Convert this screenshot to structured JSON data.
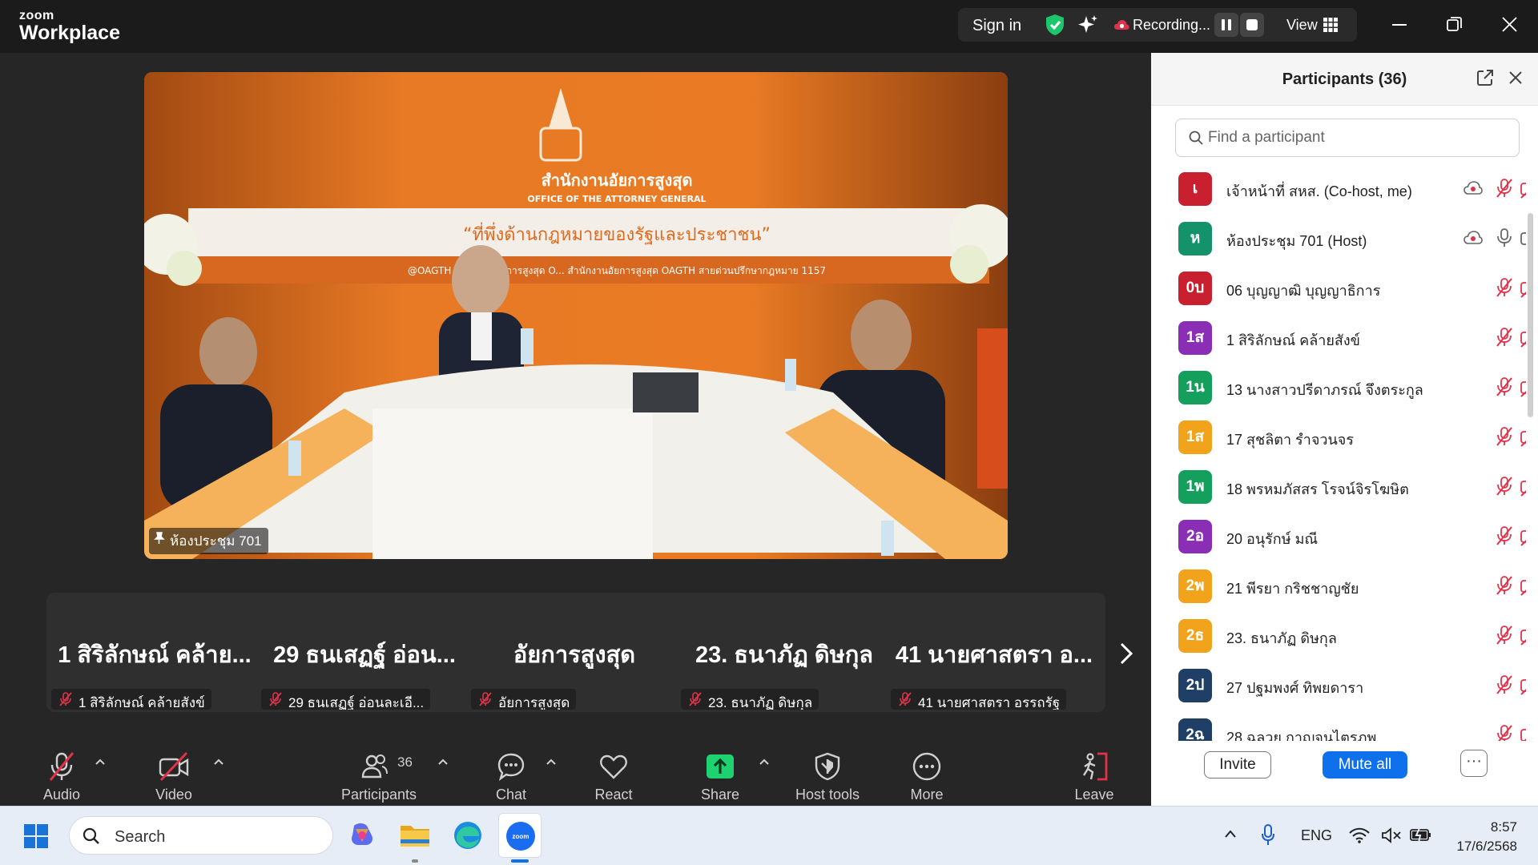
{
  "app": {
    "logo_top": "zoom",
    "logo_bottom": "Workplace"
  },
  "topbar": {
    "sign_in": "Sign in",
    "recording_label": "Recording...",
    "view_label": "View",
    "colors": {
      "shield": "#1cc66b",
      "record": "#e0334a"
    }
  },
  "video": {
    "name_tag": "ห้องประชุม 701",
    "backdrop_title_th": "สำนักงานอัยการสูงสุด",
    "backdrop_title_en": "OFFICE OF THE ATTORNEY GENERAL",
    "backdrop_slogan": "“ที่พึ่งด้านกฎหมายของรัฐและประชาชน”",
    "backdrop_socials": "@OAGTH   สำนักงานอัยการสูงสุด O...   สำนักงานอัยการสูงสุด OAGTH   สายด่วนปรึกษากฎหมาย 1157"
  },
  "strip": {
    "tiles": [
      {
        "big": "1 สิริลักษณ์ คล้าย...",
        "small": "1 สิริลักษณ์ คล้ายสังข์"
      },
      {
        "big": "29 ธนเสฏฐ์  อ่อน...",
        "small": "29 ธนเสฏฐ์ อ่อนละเอี..."
      },
      {
        "big": "อัยการสูงสุด",
        "small": "อัยการสูงสุด"
      },
      {
        "big": "23. ธนาภัฏ ดิษกุล",
        "small": "23. ธนาภัฏ ดิษกุล"
      },
      {
        "big": "41 นายศาสตรา อ...",
        "small": "41 นายศาสตรา อรรถรัฐ"
      }
    ]
  },
  "toolbar": {
    "audio": "Audio",
    "video": "Video",
    "participants": "Participants",
    "participants_count": "36",
    "chat": "Chat",
    "react": "React",
    "share": "Share",
    "host_tools": "Host tools",
    "more": "More",
    "leave": "Leave",
    "colors": {
      "share": "#1ed36f",
      "muted": "#e0334a",
      "leave": "#e0334a"
    }
  },
  "panel": {
    "title": "Participants (36)",
    "search_placeholder": "Find a participant",
    "invite": "Invite",
    "mute_all": "Mute all",
    "more": "···",
    "participants": [
      {
        "initials": "เ",
        "name": "เจ้าหน้าที่ สหส. (Co-host, me)",
        "color": "#c8202e",
        "recording": true,
        "mic": "muted",
        "cam": "off"
      },
      {
        "initials": "ห",
        "name": "ห้องประชุม 701 (Host)",
        "color": "#14936a",
        "recording": true,
        "mic": "on",
        "cam": "on"
      },
      {
        "initials": "0บ",
        "name": "06 บุญญาฒิ บุญญาธิการ",
        "color": "#c8202e",
        "recording": false,
        "mic": "muted",
        "cam": "off"
      },
      {
        "initials": "1ส",
        "name": "1 สิริลักษณ์ คล้ายสังข์",
        "color": "#8a2fb5",
        "recording": false,
        "mic": "muted",
        "cam": "off"
      },
      {
        "initials": "1น",
        "name": "13 นางสาวปรีดาภรณ์ จึงตระกูล",
        "color": "#14a05c",
        "recording": false,
        "mic": "muted",
        "cam": "off"
      },
      {
        "initials": "1ส",
        "name": "17 สุชลิตา รำจวนจร",
        "color": "#f1a31b",
        "recording": false,
        "mic": "muted",
        "cam": "off"
      },
      {
        "initials": "1พ",
        "name": "18 พรหมภัสสร โรจน์จิรโฆษิต",
        "color": "#14a05c",
        "recording": false,
        "mic": "muted",
        "cam": "off"
      },
      {
        "initials": "2อ",
        "name": "20 อนุรักษ์ มณี",
        "color": "#8a2fb5",
        "recording": false,
        "mic": "muted",
        "cam": "off"
      },
      {
        "initials": "2พ",
        "name": "21 พีรยา กริชชาญชัย",
        "color": "#f1a31b",
        "recording": false,
        "mic": "muted",
        "cam": "off"
      },
      {
        "initials": "2ธ",
        "name": "23. ธนาภัฏ ดิษกุล",
        "color": "#f1a31b",
        "recording": false,
        "mic": "muted",
        "cam": "off"
      },
      {
        "initials": "2ป",
        "name": "27 ปฐมพงศ์ ทิพยดารา",
        "color": "#1f3f66",
        "recording": false,
        "mic": "muted",
        "cam": "off"
      },
      {
        "initials": "2ฉ",
        "name": "28 ฉลวย กาญจนไตรภพ",
        "color": "#1f3f66",
        "recording": false,
        "mic": "muted",
        "cam": "off"
      }
    ]
  },
  "taskbar": {
    "search": "Search",
    "language": "ENG",
    "time": "8:57",
    "date": "17/6/2568"
  }
}
